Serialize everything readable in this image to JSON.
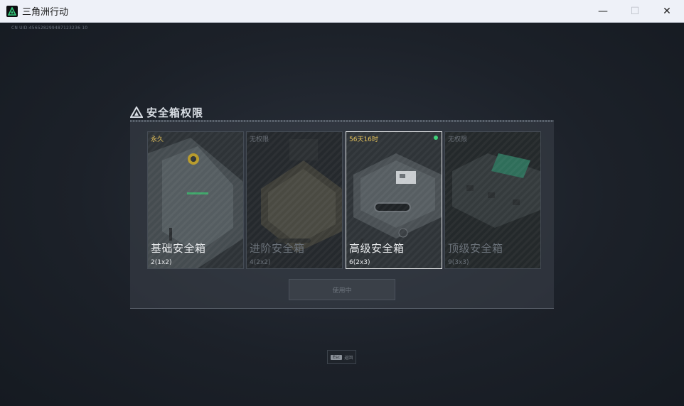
{
  "window": {
    "title": "三角洲行动",
    "minimize": "—",
    "maximize": "☐",
    "close": "✕"
  },
  "game": {
    "uid_text": "CN  UID:456528299487123236 10"
  },
  "panel": {
    "title": "安全箱权限",
    "cards": [
      {
        "badge": "永久",
        "name": "基础安全箱",
        "size": "2(1x2)",
        "state": "owned"
      },
      {
        "badge": "无权限",
        "name": "进阶安全箱",
        "size": "4(2x2)",
        "state": "locked"
      },
      {
        "badge": "56天16时",
        "name": "高级安全箱",
        "size": "6(2x3)",
        "state": "selected"
      },
      {
        "badge": "无权限",
        "name": "顶级安全箱",
        "size": "9(3x3)",
        "state": "locked"
      }
    ],
    "use_button": "使用中"
  },
  "footer": {
    "esc_key": "Esc",
    "esc_label": "返回"
  },
  "colors": {
    "badge_gold": "#e6c35a",
    "active_dot": "#3fd27a"
  }
}
